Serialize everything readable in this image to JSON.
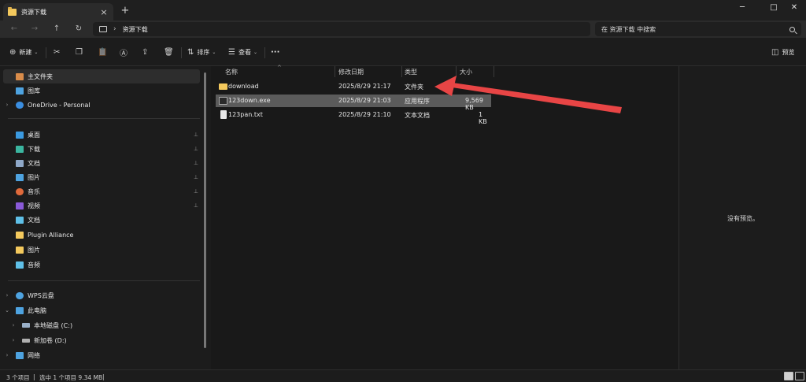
{
  "window": {
    "tab_title": "资源下载",
    "tab_close": "×",
    "new_tab": "+",
    "minimize": "─",
    "maximize": "□",
    "close": "✕"
  },
  "address": {
    "back_icon": "←",
    "forward_icon": "→",
    "up_icon": "↑",
    "refresh_icon": "↻",
    "crumb_sep": "›",
    "crumb": "资源下载",
    "search_placeholder": "在 资源下载 中搜索"
  },
  "toolbar": {
    "new_label": "新建",
    "sort_label": "排序",
    "view_label": "查看",
    "more_label": "···",
    "preview_label": "预览",
    "icons": {
      "new": "⊕",
      "cut": "✂",
      "copy": "❐",
      "paste": "📋",
      "rename": "Ⓐ",
      "share": "⇪",
      "delete": "🗑",
      "sort": "⇅",
      "view": "☰",
      "preview": "◫"
    }
  },
  "sidebar": {
    "items": [
      {
        "label": "主文件夹",
        "icon": "home-icon",
        "color": "#d98c4a"
      },
      {
        "label": "图库",
        "icon": "gallery-icon",
        "color": "#4ea3e0"
      },
      {
        "label": "OneDrive - Personal",
        "icon": "onedrive-icon",
        "color": "#3b8ee0"
      },
      {
        "label": "桌面",
        "icon": "desktop-icon",
        "color": "#3b9ae0"
      },
      {
        "label": "下载",
        "icon": "download-icon",
        "color": "#3bb6a0"
      },
      {
        "label": "文档",
        "icon": "document-icon",
        "color": "#8fa8c8"
      },
      {
        "label": "图片",
        "icon": "picture-icon",
        "color": "#4ea3e0"
      },
      {
        "label": "音乐",
        "icon": "music-icon",
        "color": "#e06a3b"
      },
      {
        "label": "视频",
        "icon": "video-icon",
        "color": "#8a5ad8"
      },
      {
        "label": "文档",
        "icon": "file-icon",
        "color": "#5fc0e8"
      },
      {
        "label": "Plugin Alliance",
        "icon": "folder-icon",
        "color": "#f4c95d"
      },
      {
        "label": "图片",
        "icon": "folder-icon",
        "color": "#f4c95d"
      },
      {
        "label": "音频",
        "icon": "file-icon",
        "color": "#5fc0e8"
      },
      {
        "label": "WPS云盘",
        "icon": "cloud-icon",
        "color": "#4ea3e0"
      },
      {
        "label": "此电脑",
        "icon": "computer-icon",
        "color": "#4ea3e0"
      },
      {
        "label": "本地磁盘 (C:)",
        "icon": "drive-icon",
        "color": "#9ab0c8"
      },
      {
        "label": "新加卷 (D:)",
        "icon": "drive-icon",
        "color": "#b0b0b0"
      },
      {
        "label": "网络",
        "icon": "network-icon",
        "color": "#4ea3e0"
      }
    ],
    "chevron_right": "›",
    "chevron_down": "⌄",
    "pin_icon": "📌"
  },
  "files": {
    "headers": [
      "名称",
      "修改日期",
      "类型",
      "大小"
    ],
    "sort_caret": "^",
    "rows": [
      {
        "name": "download",
        "date": "2025/8/29 21:17",
        "type": "文件夹",
        "size": "",
        "icon": "folder-icon"
      },
      {
        "name": "123down.exe",
        "date": "2025/8/29 21:03",
        "type": "应用程序",
        "size": "9,569 KB",
        "icon": "exe-icon"
      },
      {
        "name": "123pan.txt",
        "date": "2025/8/29 21:10",
        "type": "文本文档",
        "size": "1 KB",
        "icon": "text-file-icon"
      }
    ]
  },
  "preview": {
    "empty_text": "没有预览。"
  },
  "status": {
    "count": "3 个项目",
    "selected": "选中 1 个项目  9.34 MB",
    "sep": "|"
  },
  "colors": {
    "accent": "#4cc2ff",
    "folder": "#f4c95d",
    "arrow": "#e84545"
  }
}
